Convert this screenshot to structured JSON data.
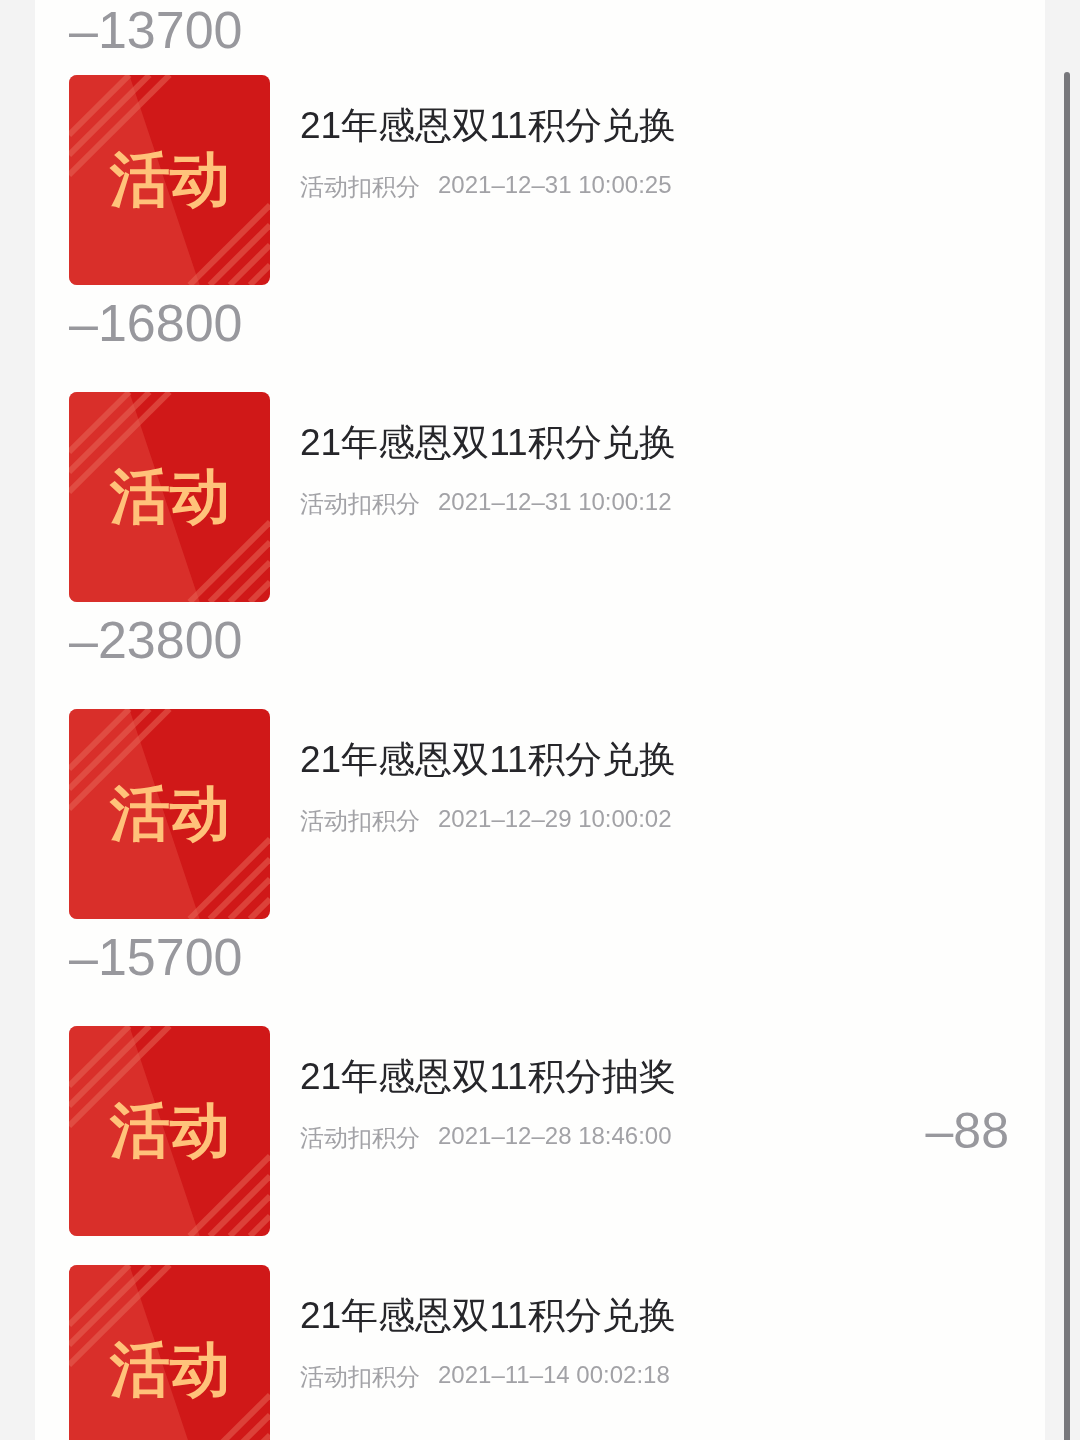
{
  "cut_off_amount": "–13700",
  "records": [
    {
      "badge_text": "活动",
      "title": "21年感恩双11积分兑换",
      "type": "活动扣积分",
      "time": "2021–12–31 10:00:25",
      "amount": "–16800",
      "kind": "below"
    },
    {
      "badge_text": "活动",
      "title": "21年感恩双11积分兑换",
      "type": "活动扣积分",
      "time": "2021–12–31 10:00:12",
      "amount": "–23800",
      "kind": "below"
    },
    {
      "badge_text": "活动",
      "title": "21年感恩双11积分兑换",
      "type": "活动扣积分",
      "time": "2021–12–29 10:00:02",
      "amount": "–15700",
      "kind": "below"
    },
    {
      "badge_text": "活动",
      "title": "21年感恩双11积分抽奖",
      "type": "活动扣积分",
      "time": "2021–12–28 18:46:00",
      "amount": "–88",
      "kind": "inline"
    },
    {
      "badge_text": "活动",
      "title": "21年感恩双11积分兑换",
      "type": "活动扣积分",
      "time": "2021–11–14 00:02:18",
      "kind": "none"
    }
  ]
}
